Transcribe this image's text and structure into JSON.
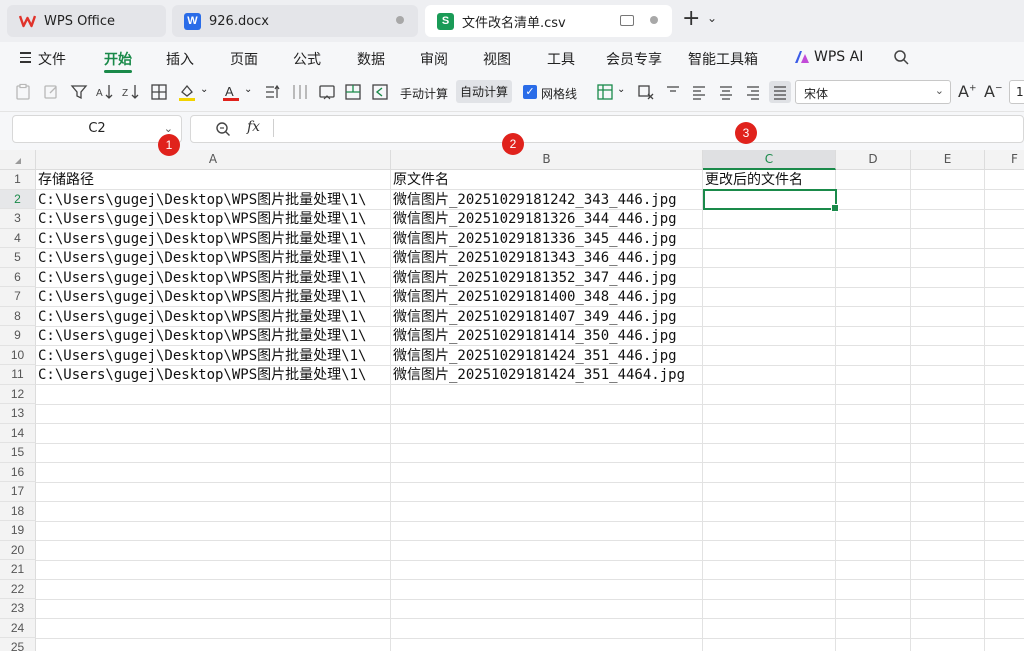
{
  "tabs": [
    {
      "label": "WPS Office",
      "icon": "wps-logo-icon"
    },
    {
      "label": "926.docx",
      "icon": "word-doc-icon",
      "icon_letter": "W"
    },
    {
      "label": "文件改名清单.csv",
      "icon": "spreadsheet-icon",
      "icon_letter": "S"
    }
  ],
  "menu": {
    "file": "文件",
    "items": [
      "开始",
      "插入",
      "页面",
      "公式",
      "数据",
      "审阅",
      "视图",
      "工具",
      "会员专享",
      "智能工具箱"
    ],
    "active": "开始",
    "ai": "WPS AI"
  },
  "toolbar": {
    "manual_calc": "手动计算",
    "auto_calc": "自动计算",
    "gridlines": "网格线",
    "gridlines_checked": true,
    "font_name": "宋体",
    "font_size": "1"
  },
  "formula_bar": {
    "cell_ref": "C2",
    "fx": "fx",
    "value": ""
  },
  "badges": [
    "1",
    "2",
    "3"
  ],
  "sheet": {
    "columns": [
      "A",
      "B",
      "C",
      "D",
      "E",
      "F"
    ],
    "selected_column": "C",
    "selected_row": 2,
    "row_numbers": [
      "1",
      "2",
      "3",
      "4",
      "5",
      "6",
      "7",
      "8",
      "9",
      "10",
      "11",
      "12",
      "13",
      "14",
      "15",
      "16",
      "17",
      "18",
      "19",
      "20",
      "21",
      "22",
      "23",
      "24",
      "25"
    ],
    "headers": [
      "存储路径",
      "原文件名",
      "更改后的文件名"
    ],
    "rows": [
      [
        "C:\\Users\\gugej\\Desktop\\WPS图片批量处理\\1\\",
        "微信图片_20251029181242_343_446.jpg",
        ""
      ],
      [
        "C:\\Users\\gugej\\Desktop\\WPS图片批量处理\\1\\",
        "微信图片_20251029181326_344_446.jpg",
        ""
      ],
      [
        "C:\\Users\\gugej\\Desktop\\WPS图片批量处理\\1\\",
        "微信图片_20251029181336_345_446.jpg",
        ""
      ],
      [
        "C:\\Users\\gugej\\Desktop\\WPS图片批量处理\\1\\",
        "微信图片_20251029181343_346_446.jpg",
        ""
      ],
      [
        "C:\\Users\\gugej\\Desktop\\WPS图片批量处理\\1\\",
        "微信图片_20251029181352_347_446.jpg",
        ""
      ],
      [
        "C:\\Users\\gugej\\Desktop\\WPS图片批量处理\\1\\",
        "微信图片_20251029181400_348_446.jpg",
        ""
      ],
      [
        "C:\\Users\\gugej\\Desktop\\WPS图片批量处理\\1\\",
        "微信图片_20251029181407_349_446.jpg",
        ""
      ],
      [
        "C:\\Users\\gugej\\Desktop\\WPS图片批量处理\\1\\",
        "微信图片_20251029181414_350_446.jpg",
        ""
      ],
      [
        "C:\\Users\\gugej\\Desktop\\WPS图片批量处理\\1\\",
        "微信图片_20251029181424_351_446.jpg",
        ""
      ],
      [
        "C:\\Users\\gugej\\Desktop\\WPS图片批量处理\\1\\",
        "微信图片_20251029181424_351_4464.jpg",
        ""
      ]
    ]
  },
  "colors": {
    "accent_green": "#1a8a4a",
    "badge_red": "#e0221c",
    "word_blue": "#2a6ce8",
    "sheet_green": "#1a9b57"
  }
}
